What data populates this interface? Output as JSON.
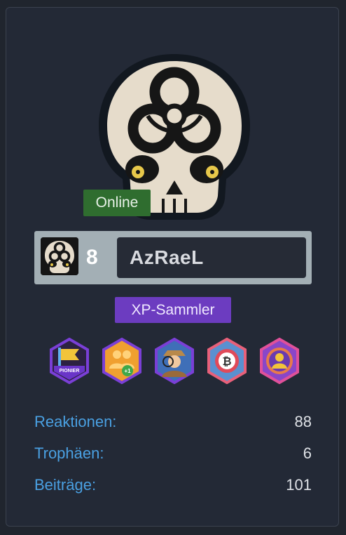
{
  "user": {
    "status": "Online",
    "level": "8",
    "name": "AzRaeL",
    "rank": "XP-Sammler"
  },
  "badges": [
    {
      "name": "pionier-badge",
      "label": "PIONIER",
      "color": "#7a3fd6"
    },
    {
      "name": "referral-badge",
      "label": "+1",
      "color": "#f0a030"
    },
    {
      "name": "detective-badge",
      "color": "#7a3fd6"
    },
    {
      "name": "crypto-badge",
      "label": "₿",
      "color": "#4b8fd6"
    },
    {
      "name": "profile-badge",
      "color": "#e0509a"
    }
  ],
  "stats": [
    {
      "label": "Reaktionen:",
      "value": "88"
    },
    {
      "label": "Trophäen:",
      "value": "6"
    },
    {
      "label": "Beiträge:",
      "value": "101"
    }
  ],
  "colors": {
    "online": "#2f6d2f",
    "rank": "#6c3cc0",
    "stat_label": "#4aa0e2"
  }
}
